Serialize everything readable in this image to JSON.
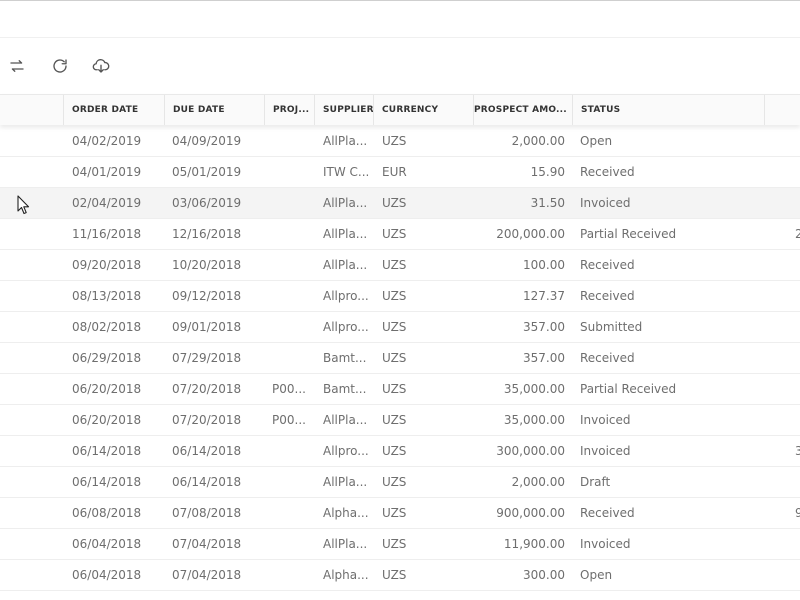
{
  "toolbar": {
    "buttons": [
      {
        "name": "swap-icon"
      },
      {
        "name": "refresh-icon"
      },
      {
        "name": "download-icon"
      }
    ]
  },
  "grid": {
    "columns": [
      {
        "key": "order_date",
        "label": "ORDER DATE"
      },
      {
        "key": "due_date",
        "label": "DUE DATE"
      },
      {
        "key": "project",
        "label": "PROJ..."
      },
      {
        "key": "supplier",
        "label": "SUPPLIER"
      },
      {
        "key": "currency",
        "label": "CURRENCY"
      },
      {
        "key": "prospect_amount",
        "label": "PROSPECT AMO..."
      },
      {
        "key": "status",
        "label": "STATUS"
      }
    ],
    "rows": [
      {
        "order_date": "04/02/2019",
        "due_date": "04/09/2019",
        "project": "",
        "supplier": "AllPla...",
        "currency": "UZS",
        "prospect_amount": "2,000.00",
        "status": "Open",
        "extra": ""
      },
      {
        "order_date": "04/01/2019",
        "due_date": "05/01/2019",
        "project": "",
        "supplier": "ITW C...",
        "currency": "EUR",
        "prospect_amount": "15.90",
        "status": "Received",
        "extra": ""
      },
      {
        "order_date": "02/04/2019",
        "due_date": "03/06/2019",
        "project": "",
        "supplier": "AllPla...",
        "currency": "UZS",
        "prospect_amount": "31.50",
        "status": "Invoiced",
        "extra": ""
      },
      {
        "order_date": "11/16/2018",
        "due_date": "12/16/2018",
        "project": "",
        "supplier": "AllPla...",
        "currency": "UZS",
        "prospect_amount": "200,000.00",
        "status": "Partial Received",
        "extra": "2"
      },
      {
        "order_date": "09/20/2018",
        "due_date": "10/20/2018",
        "project": "",
        "supplier": "AllPla...",
        "currency": "UZS",
        "prospect_amount": "100.00",
        "status": "Received",
        "extra": ""
      },
      {
        "order_date": "08/13/2018",
        "due_date": "09/12/2018",
        "project": "",
        "supplier": "Allpro...",
        "currency": "UZS",
        "prospect_amount": "127.37",
        "status": "Received",
        "extra": ""
      },
      {
        "order_date": "08/02/2018",
        "due_date": "09/01/2018",
        "project": "",
        "supplier": "Allpro...",
        "currency": "UZS",
        "prospect_amount": "357.00",
        "status": "Submitted",
        "extra": ""
      },
      {
        "order_date": "06/29/2018",
        "due_date": "07/29/2018",
        "project": "",
        "supplier": "Bamt...",
        "currency": "UZS",
        "prospect_amount": "357.00",
        "status": "Received",
        "extra": ""
      },
      {
        "order_date": "06/20/2018",
        "due_date": "07/20/2018",
        "project": "P00...",
        "supplier": "Bamt...",
        "currency": "UZS",
        "prospect_amount": "35,000.00",
        "status": "Partial Received",
        "extra": ""
      },
      {
        "order_date": "06/20/2018",
        "due_date": "07/20/2018",
        "project": "P00...",
        "supplier": "AllPla...",
        "currency": "UZS",
        "prospect_amount": "35,000.00",
        "status": "Invoiced",
        "extra": ""
      },
      {
        "order_date": "06/14/2018",
        "due_date": "06/14/2018",
        "project": "",
        "supplier": "Allpro...",
        "currency": "UZS",
        "prospect_amount": "300,000.00",
        "status": "Invoiced",
        "extra": "3"
      },
      {
        "order_date": "06/14/2018",
        "due_date": "06/14/2018",
        "project": "",
        "supplier": "AllPla...",
        "currency": "UZS",
        "prospect_amount": "2,000.00",
        "status": "Draft",
        "extra": ""
      },
      {
        "order_date": "06/08/2018",
        "due_date": "07/08/2018",
        "project": "",
        "supplier": "Alpha...",
        "currency": "UZS",
        "prospect_amount": "900,000.00",
        "status": "Received",
        "extra": "9"
      },
      {
        "order_date": "06/04/2018",
        "due_date": "07/04/2018",
        "project": "",
        "supplier": "AllPla...",
        "currency": "UZS",
        "prospect_amount": "11,900.00",
        "status": "Invoiced",
        "extra": ""
      },
      {
        "order_date": "06/04/2018",
        "due_date": "07/04/2018",
        "project": "",
        "supplier": "Alpha...",
        "currency": "UZS",
        "prospect_amount": "300.00",
        "status": "Open",
        "extra": ""
      }
    ]
  }
}
